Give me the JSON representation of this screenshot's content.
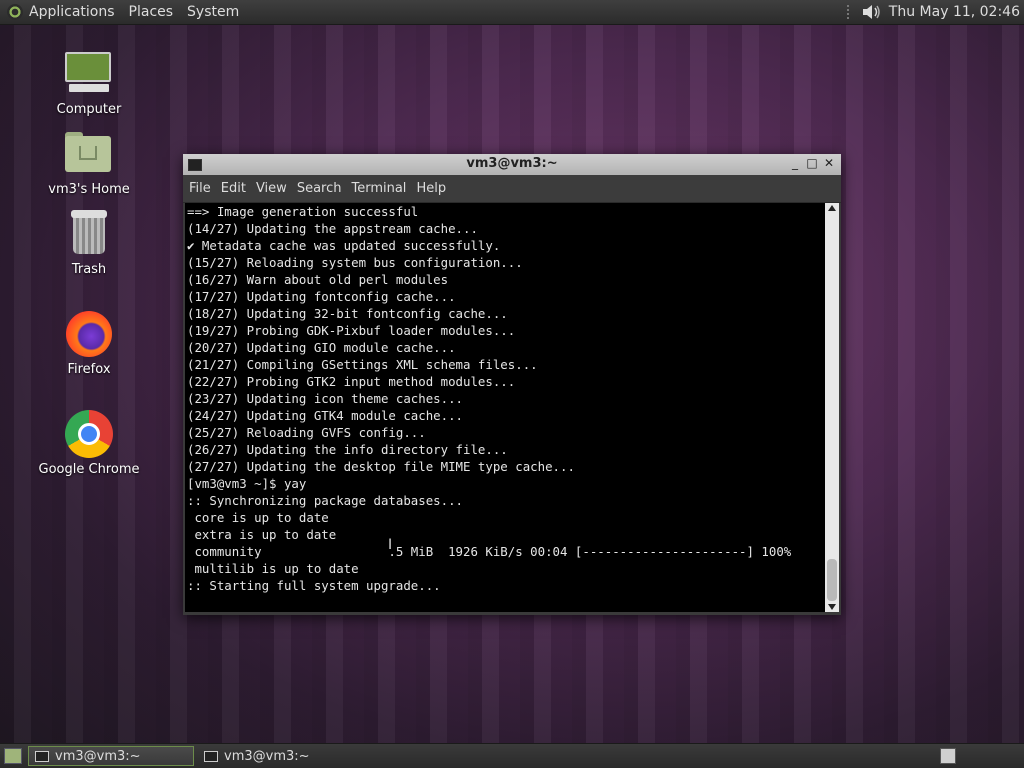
{
  "top_panel": {
    "menus": [
      "Applications",
      "Places",
      "System"
    ],
    "clock": "Thu May 11, 02:46",
    "icons": [
      "gnome-foot-icon",
      "speaker-icon"
    ]
  },
  "desktop": {
    "icons": [
      {
        "label": "Computer",
        "icon": "computer-icon"
      },
      {
        "label": "vm3's Home",
        "icon": "home-folder-icon"
      },
      {
        "label": "Trash",
        "icon": "trash-icon"
      },
      {
        "label": "Firefox",
        "icon": "firefox-icon"
      },
      {
        "label": "Google Chrome",
        "icon": "chrome-icon"
      }
    ]
  },
  "terminal": {
    "title": "vm3@vm3:~",
    "menu": [
      "File",
      "Edit",
      "View",
      "Search",
      "Terminal",
      "Help"
    ],
    "lines": [
      "==> Image generation successful",
      "(14/27) Updating the appstream cache...",
      "✔ Metadata cache was updated successfully.",
      "(15/27) Reloading system bus configuration...",
      "(16/27) Warn about old perl modules",
      "(17/27) Updating fontconfig cache...",
      "(18/27) Updating 32-bit fontconfig cache...",
      "(19/27) Probing GDK-Pixbuf loader modules...",
      "(20/27) Updating GIO module cache...",
      "(21/27) Compiling GSettings XML schema files...",
      "(22/27) Probing GTK2 input method modules...",
      "(23/27) Updating icon theme caches...",
      "(24/27) Updating GTK4 module cache...",
      "(25/27) Reloading GVFS config...",
      "(26/27) Updating the info directory file...",
      "(27/27) Updating the desktop file MIME type cache...",
      "[vm3@vm3 ~]$ yay",
      ":: Synchronizing package databases...",
      " core is up to date",
      " extra is up to date",
      " community                 .5 MiB  1926 KiB/s 00:04 [----------------------] 100%",
      " multilib is up to date",
      ":: Starting full system upgrade..."
    ],
    "controls": {
      "minimize": "_",
      "maximize": "□",
      "close": "✕"
    }
  },
  "taskbar": {
    "tasks": [
      {
        "label": "vm3@vm3:~",
        "active": true
      },
      {
        "label": "vm3@vm3:~",
        "active": false
      }
    ]
  }
}
